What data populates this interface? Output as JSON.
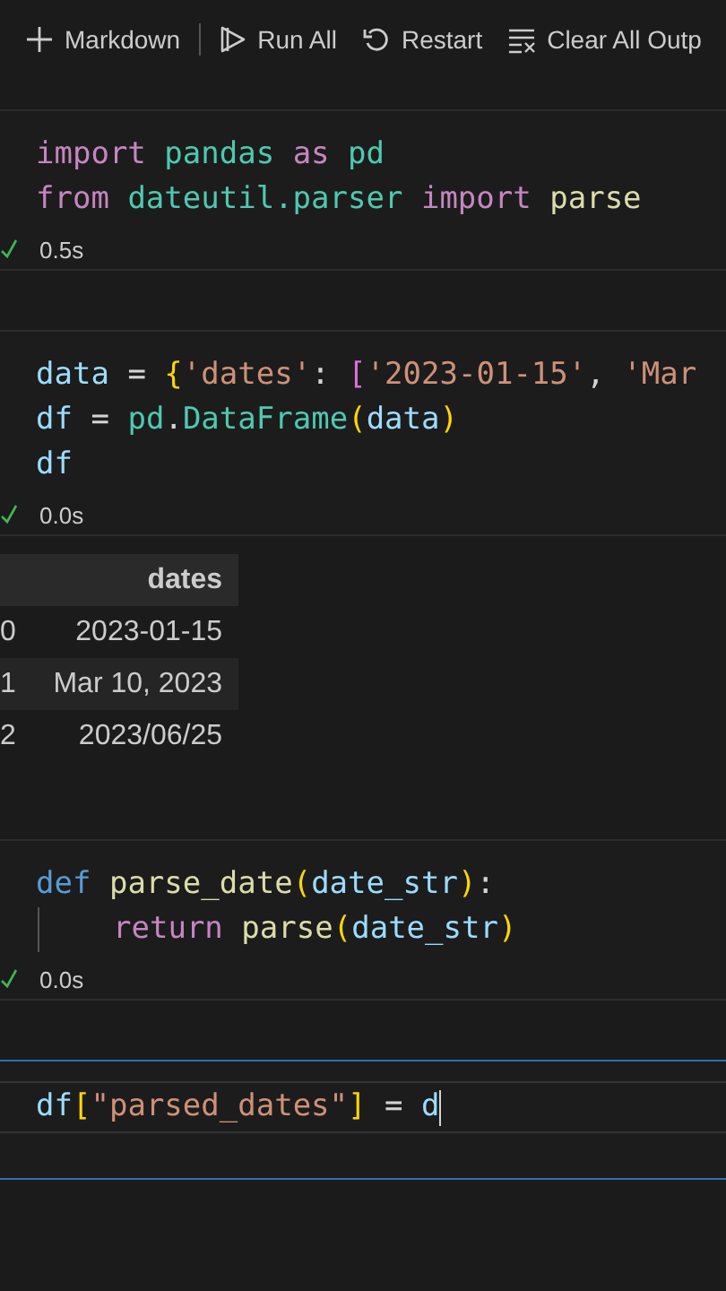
{
  "toolbar": [
    {
      "kind": "add",
      "label": "Markdown"
    },
    {
      "kind": "run",
      "label": "Run All"
    },
    {
      "kind": "restart",
      "label": "Restart"
    },
    {
      "kind": "clear",
      "label": "Clear All Outp"
    }
  ],
  "cells": [
    {
      "focused": false,
      "lines": [
        {
          "tokens": [
            {
              "text": "import ",
              "kind": "keyword"
            },
            {
              "text": "pandas ",
              "kind": "module"
            },
            {
              "text": "as ",
              "kind": "keyword"
            },
            {
              "text": "pd",
              "kind": "module"
            }
          ]
        },
        {
          "tokens": [
            {
              "text": "from ",
              "kind": "keyword"
            },
            {
              "text": "dateutil.parser ",
              "kind": "module"
            },
            {
              "text": "import ",
              "kind": "keyword"
            },
            {
              "text": "parse",
              "kind": "function"
            }
          ]
        }
      ],
      "status": {
        "done": true,
        "time": "0.5s"
      }
    },
    {
      "focused": false,
      "lines": [
        {
          "tokens": [
            {
              "text": "data",
              "kind": "variable"
            },
            {
              "text": " = "
            },
            {
              "text": "{",
              "kind": "brace"
            },
            {
              "text": "'dates'",
              "kind": "string"
            },
            {
              "text": ": "
            },
            {
              "text": "[",
              "kind": "bracket"
            },
            {
              "text": "'2023-01-15'",
              "kind": "string"
            },
            {
              "text": ", "
            },
            {
              "text": "'Mar",
              "kind": "string"
            }
          ]
        },
        {
          "tokens": [
            {
              "text": "df",
              "kind": "variable"
            },
            {
              "text": " = "
            },
            {
              "text": "pd",
              "kind": "module"
            },
            {
              "text": "."
            },
            {
              "text": "DataFrame",
              "kind": "module"
            },
            {
              "text": "(",
              "kind": "brace"
            },
            {
              "text": "data",
              "kind": "variable"
            },
            {
              "text": ")",
              "kind": "brace"
            }
          ]
        },
        {
          "tokens": [
            {
              "text": "df",
              "kind": "variable"
            }
          ]
        }
      ],
      "status": {
        "done": true,
        "time": "0.0s"
      },
      "output": {
        "columns": [
          "dates"
        ],
        "rows": [
          {
            "index": "0",
            "cells": [
              "2023-01-15"
            ]
          },
          {
            "index": "1",
            "cells": [
              "Mar 10, 2023"
            ]
          },
          {
            "index": "2",
            "cells": [
              "2023/06/25"
            ]
          }
        ]
      }
    },
    {
      "focused": false,
      "lines": [
        {
          "tokens": [
            {
              "text": "def ",
              "kind": "storage"
            },
            {
              "text": "parse_date",
              "kind": "function"
            },
            {
              "text": "(",
              "kind": "brace"
            },
            {
              "text": "date_str",
              "kind": "variable"
            },
            {
              "text": ")",
              "kind": "brace"
            },
            {
              "text": ":"
            }
          ]
        },
        {
          "indented": true,
          "tokens": [
            {
              "text": "return ",
              "kind": "keyword"
            },
            {
              "text": "parse",
              "kind": "function"
            },
            {
              "text": "(",
              "kind": "brace"
            },
            {
              "text": "date_str",
              "kind": "variable"
            },
            {
              "text": ")",
              "kind": "brace"
            }
          ]
        }
      ],
      "status": {
        "done": true,
        "time": "0.0s"
      }
    },
    {
      "focused": true,
      "lines": [
        {
          "tokens": [
            {
              "text": "df",
              "kind": "variable"
            },
            {
              "text": "[",
              "kind": "brace"
            },
            {
              "text": "\"parsed_dates\"",
              "kind": "string"
            },
            {
              "text": "]",
              "kind": "brace"
            },
            {
              "text": " = "
            },
            {
              "text": "d",
              "kind": "variable"
            }
          ]
        }
      ]
    }
  ]
}
